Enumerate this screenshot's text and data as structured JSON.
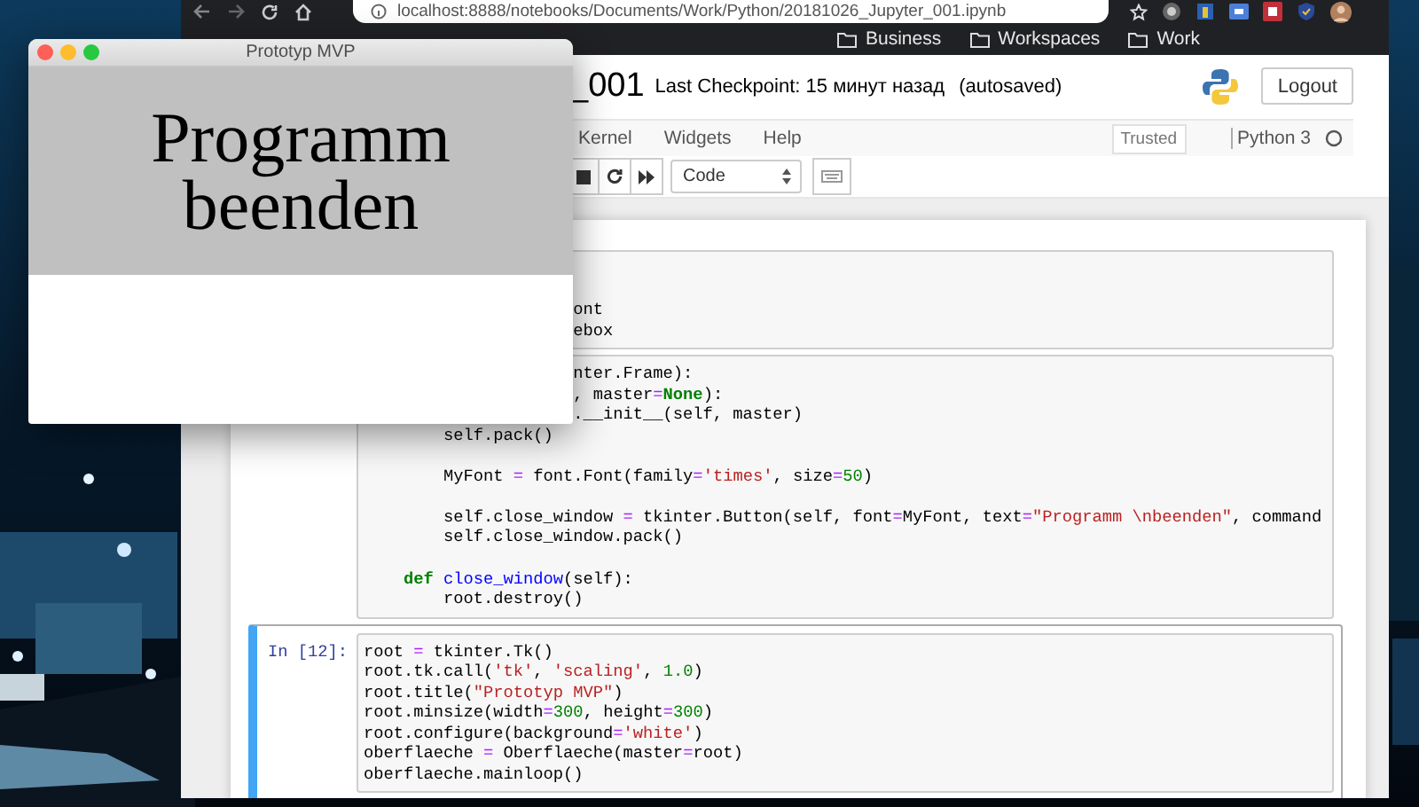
{
  "browser": {
    "address": "localhost:8888/notebooks/Documents/Work/Python/20181026_Jupyter_001.ipynb",
    "bookmarks": [
      "Business",
      "Workspaces",
      "Work"
    ]
  },
  "notebook": {
    "title": "_001",
    "checkpoint": "Last Checkpoint: 15 минут назад",
    "save_status": "(autosaved)",
    "logout": "Logout",
    "menu": [
      "Kernel",
      "Widgets",
      "Help"
    ],
    "trusted": "Trusted",
    "kernel": "Python 3",
    "kernel_busy": false,
    "cell_type": "Code"
  },
  "cells": [
    {
      "selected": false,
      "lines": [
        {
          "kind": "code",
          "spans": [
            {
              "text": "                     ont",
              "kind": "plain"
            }
          ]
        },
        {
          "kind": "code",
          "spans": [
            {
              "text": "                     ebox",
              "kind": "plain"
            }
          ]
        }
      ]
    },
    {
      "selected": false,
      "lines": [
        {
          "kind": "code",
          "spans": [
            {
              "text": "                     nter.Frame):",
              "kind": "plain"
            }
          ]
        },
        {
          "kind": "code",
          "spans": [
            {
              "text": "                     , master",
              "kind": "plain"
            },
            {
              "text": "=",
              "kind": "operator"
            },
            {
              "text": "None",
              "kind": "keyword"
            },
            {
              "text": "):",
              "kind": "plain"
            }
          ]
        },
        {
          "kind": "code",
          "spans": [
            {
              "text": "                     .__init__(self, master)",
              "kind": "plain"
            }
          ]
        },
        {
          "kind": "code",
          "spans": [
            {
              "text": "        self.pack()",
              "kind": "plain"
            }
          ]
        },
        {
          "kind": "blank"
        },
        {
          "kind": "code",
          "spans": [
            {
              "text": "        MyFont ",
              "kind": "plain"
            },
            {
              "text": "=",
              "kind": "operator"
            },
            {
              "text": " font.Font(family",
              "kind": "plain"
            },
            {
              "text": "=",
              "kind": "operator"
            },
            {
              "text": "'times'",
              "kind": "string"
            },
            {
              "text": ", size",
              "kind": "plain"
            },
            {
              "text": "=",
              "kind": "operator"
            },
            {
              "text": "50",
              "kind": "number"
            },
            {
              "text": ")",
              "kind": "plain"
            }
          ]
        },
        {
          "kind": "blank"
        },
        {
          "kind": "code",
          "spans": [
            {
              "text": "        self.close_window ",
              "kind": "plain"
            },
            {
              "text": "=",
              "kind": "operator"
            },
            {
              "text": " tkinter.Button(self, font",
              "kind": "plain"
            },
            {
              "text": "=",
              "kind": "operator"
            },
            {
              "text": "MyFont, text",
              "kind": "plain"
            },
            {
              "text": "=",
              "kind": "operator"
            },
            {
              "text": "\"Programm \\nbeenden\"",
              "kind": "string"
            },
            {
              "text": ", command",
              "kind": "plain"
            }
          ]
        },
        {
          "kind": "code",
          "spans": [
            {
              "text": "        self.close_window.pack()",
              "kind": "plain"
            }
          ]
        },
        {
          "kind": "blank"
        },
        {
          "kind": "code",
          "spans": [
            {
              "text": "    def",
              "kind": "keyword"
            },
            {
              "text": " close_window",
              "kind": "function"
            },
            {
              "text": "(self):",
              "kind": "plain"
            }
          ]
        },
        {
          "kind": "code",
          "spans": [
            {
              "text": "        root.destroy()",
              "kind": "plain"
            }
          ]
        }
      ]
    },
    {
      "selected": true,
      "prompt": "In [12]:",
      "lines": [
        {
          "kind": "code",
          "spans": [
            {
              "text": "root ",
              "kind": "plain"
            },
            {
              "text": "=",
              "kind": "operator"
            },
            {
              "text": " tkinter.Tk()",
              "kind": "plain"
            }
          ]
        },
        {
          "kind": "code",
          "spans": [
            {
              "text": "root.tk.call(",
              "kind": "plain"
            },
            {
              "text": "'tk'",
              "kind": "string"
            },
            {
              "text": ", ",
              "kind": "plain"
            },
            {
              "text": "'scaling'",
              "kind": "string"
            },
            {
              "text": ", ",
              "kind": "plain"
            },
            {
              "text": "1.0",
              "kind": "number"
            },
            {
              "text": ")",
              "kind": "plain"
            }
          ]
        },
        {
          "kind": "code",
          "spans": [
            {
              "text": "root.title(",
              "kind": "plain"
            },
            {
              "text": "\"Prototyp MVP\"",
              "kind": "string"
            },
            {
              "text": ")",
              "kind": "plain"
            }
          ]
        },
        {
          "kind": "code",
          "spans": [
            {
              "text": "root.minsize(width",
              "kind": "plain"
            },
            {
              "text": "=",
              "kind": "operator"
            },
            {
              "text": "300",
              "kind": "number"
            },
            {
              "text": ", height",
              "kind": "plain"
            },
            {
              "text": "=",
              "kind": "operator"
            },
            {
              "text": "300",
              "kind": "number"
            },
            {
              "text": ")",
              "kind": "plain"
            }
          ]
        },
        {
          "kind": "code",
          "spans": [
            {
              "text": "root.configure(background",
              "kind": "plain"
            },
            {
              "text": "=",
              "kind": "operator"
            },
            {
              "text": "'white'",
              "kind": "string"
            },
            {
              "text": ")",
              "kind": "plain"
            }
          ]
        },
        {
          "kind": "code",
          "spans": [
            {
              "text": "oberflaeche ",
              "kind": "plain"
            },
            {
              "text": "=",
              "kind": "operator"
            },
            {
              "text": " Oberflaeche(master",
              "kind": "plain"
            },
            {
              "text": "=",
              "kind": "operator"
            },
            {
              "text": "root)",
              "kind": "plain"
            }
          ]
        },
        {
          "kind": "code",
          "spans": [
            {
              "text": "oberflaeche.mainloop()",
              "kind": "plain"
            }
          ]
        }
      ]
    }
  ],
  "tk_window": {
    "title": "Prototyp MVP",
    "button": "Programm\nbeenden"
  }
}
